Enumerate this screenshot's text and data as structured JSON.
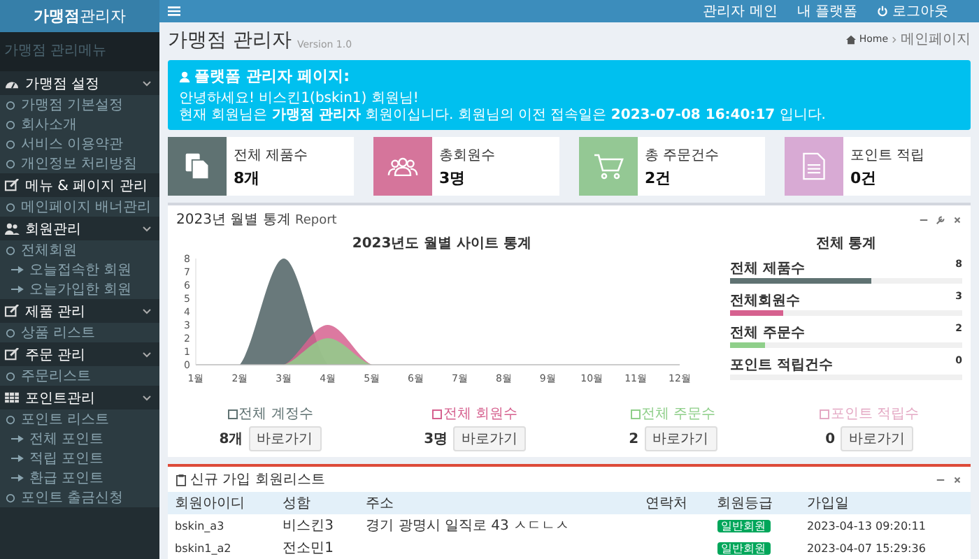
{
  "sidebar": {
    "logo": "**가맹점**관리자",
    "title": "가맹점 관리메뉴",
    "sections": [
      {
        "label": "가맹점 설정",
        "items": [
          {
            "label": "가맹점 기본설정",
            "kind": "item"
          },
          {
            "label": "회사소개",
            "kind": "item"
          },
          {
            "label": "서비스 이용약관",
            "kind": "item"
          },
          {
            "label": "개인정보 처리방침",
            "kind": "item"
          }
        ]
      },
      {
        "label": "메뉴 & 페이지 관리",
        "items": [
          {
            "label": "메인페이지 배너관리",
            "kind": "item"
          }
        ]
      },
      {
        "label": "회원관리",
        "items": [
          {
            "label": "전체회원",
            "kind": "item"
          },
          {
            "label": "오늘접속한 회원",
            "kind": "sub"
          },
          {
            "label": "오늘가입한 회원",
            "kind": "sub"
          }
        ]
      },
      {
        "label": "제품 관리",
        "items": [
          {
            "label": "상품 리스트",
            "kind": "item"
          }
        ]
      },
      {
        "label": "주문 관리",
        "items": [
          {
            "label": "주문리스트",
            "kind": "item"
          }
        ]
      },
      {
        "label": "포인트관리",
        "items": [
          {
            "label": "포인트 리스트",
            "kind": "item"
          },
          {
            "label": "전체 포인트",
            "kind": "sub"
          },
          {
            "label": "적립 포인트",
            "kind": "sub"
          },
          {
            "label": "환급 포인트",
            "kind": "sub"
          },
          {
            "label": "포인트 출금신청",
            "kind": "item"
          }
        ]
      }
    ]
  },
  "topbar": {
    "links": [
      {
        "label": "관리자 메인"
      },
      {
        "label": "내 플랫폼"
      },
      {
        "label": "로그아웃"
      }
    ]
  },
  "page": {
    "title": "가맹점 관리자",
    "version": "Version 1.0",
    "breadcrumb": [
      "Home",
      "메인페이지"
    ]
  },
  "alert": {
    "title": "플랫폼 관리자 페이지:",
    "lines": [
      "안녕하세요! 비스킨1(bskin1) 회원님!",
      "현재 회원님은 **가맹점 관리자** 회원이십니다. 회원님의 이전 접속일은 **2023-07-08 16:40:17** 입니다."
    ]
  },
  "stats": [
    {
      "label": "전체 제품수",
      "value": "8개",
      "color": "#5f7272"
    },
    {
      "label": "총회원수",
      "value": "3명",
      "color": "#d5759b"
    },
    {
      "label": "총 주문건수",
      "value": "2건",
      "color": "#94c894"
    },
    {
      "label": "포인트 적립",
      "value": "0건",
      "color": "#d8aad4"
    }
  ],
  "report": {
    "title": "2023년 월별 통계",
    "subtitle": "Report",
    "chart_data": {
      "type": "area",
      "title": "2023년도 월별 사이트 통계",
      "categories": [
        "1월",
        "2월",
        "3월",
        "4월",
        "5월",
        "6월",
        "7월",
        "8월",
        "9월",
        "10월",
        "11월",
        "12월"
      ],
      "ylim": [
        0,
        8
      ],
      "yticks": [
        0,
        1,
        2,
        3,
        4,
        5,
        6,
        7,
        8
      ],
      "series": [
        {
          "color": "#4f6164",
          "values": [
            0,
            0,
            8,
            0,
            0,
            0,
            0,
            0,
            0,
            0,
            0,
            0
          ]
        },
        {
          "color": "#d6618f",
          "values": [
            0,
            0,
            0,
            3,
            0,
            0,
            0,
            0,
            0,
            0,
            0,
            0
          ]
        },
        {
          "color": "#8fcf8a",
          "values": [
            0,
            0,
            0,
            2,
            0,
            0,
            0,
            0,
            0,
            0,
            0,
            0
          ]
        }
      ]
    },
    "totals_title": "전체 통계",
    "totals": [
      {
        "label": "전체 제품수",
        "value": "8",
        "level": 0.61,
        "color": "#5f7272"
      },
      {
        "label": "전체회원수",
        "value": "3",
        "level": 0.23,
        "color": "#d6618f"
      },
      {
        "label": "전체 주문수",
        "value": "2",
        "level": 0.15,
        "color": "#8fcf8a"
      },
      {
        "label": "포인트 적립건수",
        "value": "0",
        "level": 0
      }
    ],
    "legend": [
      {
        "label": "전체 계정수",
        "value": "8개",
        "button": "바로가기",
        "color": "#5f7272"
      },
      {
        "label": "전체 회원수",
        "value": "3명",
        "button": "바로가기",
        "color": "#d6618f"
      },
      {
        "label": "전체 주문수",
        "value": "2",
        "button": "바로가기",
        "color": "#8fcf8a"
      },
      {
        "label": "포인트 적립수",
        "value": "0",
        "button": "바로가기",
        "color": "#e4a9c4"
      }
    ]
  },
  "members": {
    "title": "신규 가입 회원리스트",
    "columns": [
      "회원아이디",
      "성함",
      "주소",
      "연락처",
      "회원등급",
      "가입일"
    ],
    "rows": [
      {
        "id": "bskin_a3",
        "name": "비스킨3",
        "address": "경기 광명시 일직로 43 ㅅㄷㄴㅅ",
        "grade": "일반회원",
        "joined": "2023-04-13 09:20:11"
      },
      {
        "id": "bskin1_a2",
        "name": "전소민1",
        "grade": "일반회원",
        "joined": "2023-04-07 15:29:36"
      }
    ]
  }
}
